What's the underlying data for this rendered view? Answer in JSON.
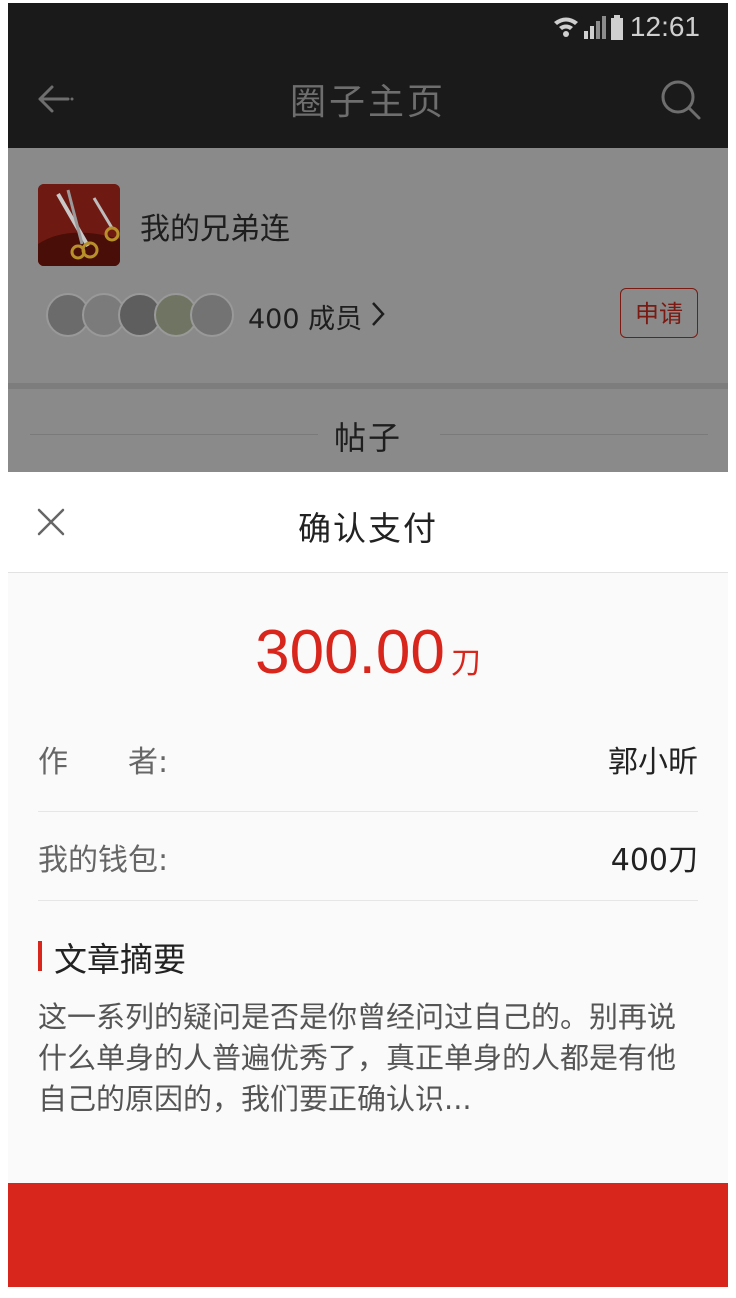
{
  "status_bar": {
    "time": "12:61",
    "icons": [
      "wifi-icon",
      "signal-icon",
      "battery-icon"
    ]
  },
  "nav": {
    "title": "圈子主页",
    "back_icon": "arrow-left-icon",
    "search_icon": "search-icon"
  },
  "circle": {
    "name": "我的兄弟连",
    "member_count_label": "400 成员",
    "apply_label": "申请"
  },
  "posts_section": {
    "title": "帖子"
  },
  "payment": {
    "title": "确认支付",
    "amount": "300.00",
    "amount_unit": "刀",
    "rows": [
      {
        "label": "作　　者:",
        "value": "郭小昕"
      },
      {
        "label": "我的钱包:",
        "value": "400刀"
      }
    ],
    "summary_title": "文章摘要",
    "summary_text": "这一系列的疑问是否是你曾经问过自己的。别再说什么单身的人普遍优秀了，真正单身的人都是有他自己的原因的，我们要正确认识..."
  },
  "colors": {
    "accent": "#d9261c",
    "nav_bg": "#1a1a1a",
    "overlay": "#8a8a8a"
  }
}
